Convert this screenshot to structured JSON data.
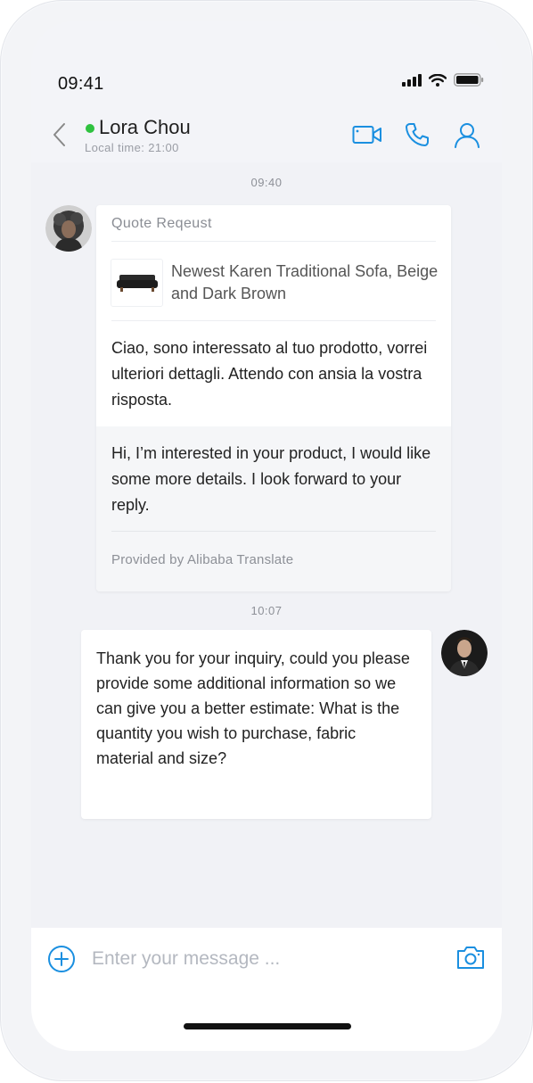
{
  "status_bar": {
    "time": "09:41",
    "icons": [
      "signal-icon",
      "wifi-icon",
      "battery-icon"
    ]
  },
  "header": {
    "contact_name": "Lora Chou",
    "local_time": "Local time: 21:00",
    "online": true,
    "actions": [
      "video-call-icon",
      "phone-call-icon",
      "profile-icon"
    ]
  },
  "messages": [
    {
      "timestamp": "09:40",
      "direction": "incoming",
      "card_title": "Quote Reqeust",
      "product_name": "Newest Karen Traditional Sofa, Beige and Dark Brown",
      "original_text": "Ciao, sono interessato al tuo prodotto, vorrei ulteriori dettagli. Attendo con ansia la vostra risposta.",
      "translated_text": "Hi, I’m interested in your product, I would like some more details. I look forward to your reply.",
      "provided_by": "Provided by Alibaba Translate"
    },
    {
      "timestamp": "10:07",
      "direction": "outgoing",
      "text": "Thank you for your inquiry, could you please provide some additional information so we can give you a better estimate: What is the quantity you wish to purchase, fabric material and size?"
    }
  ],
  "input": {
    "placeholder": "Enter your message ..."
  },
  "colors": {
    "accent": "#1a8fe0",
    "online": "#2fc23f",
    "screen_bg": "#f1f2f6"
  }
}
